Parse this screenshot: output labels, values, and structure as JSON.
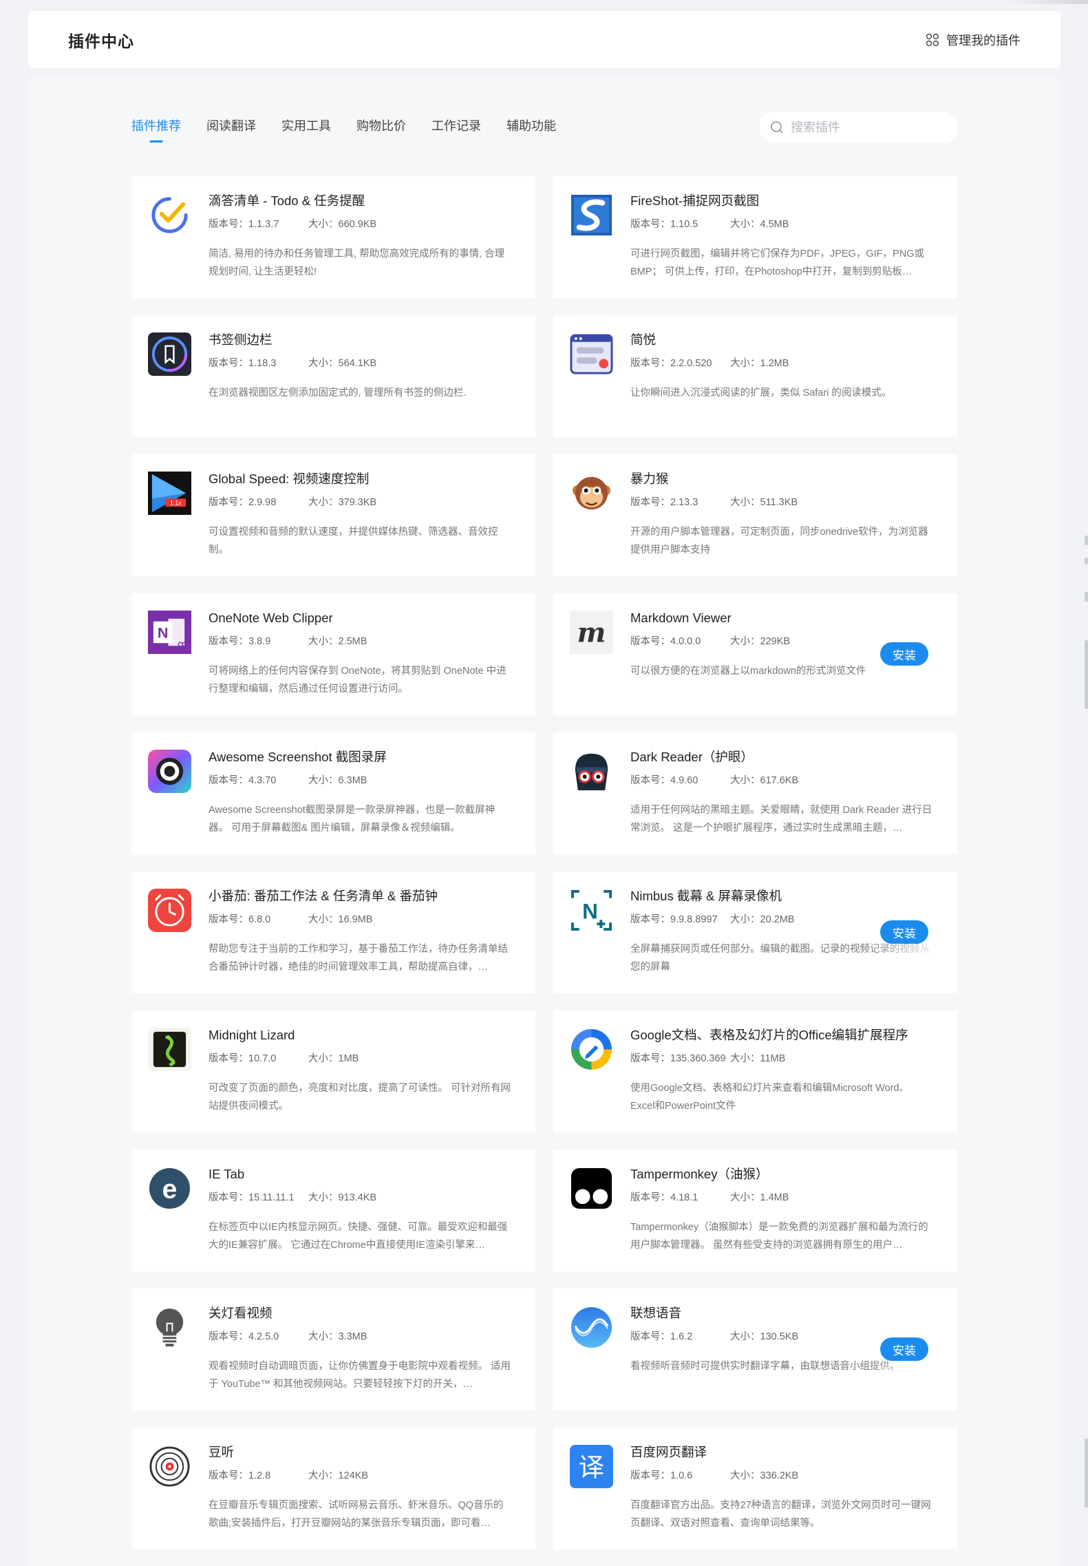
{
  "header": {
    "title": "插件中心",
    "manage_label": "管理我的插件"
  },
  "tabs": [
    {
      "label": "插件推荐",
      "active": true
    },
    {
      "label": "阅读翻译",
      "active": false
    },
    {
      "label": "实用工具",
      "active": false
    },
    {
      "label": "购物比价",
      "active": false
    },
    {
      "label": "工作记录",
      "active": false
    },
    {
      "label": "辅助功能",
      "active": false
    }
  ],
  "search": {
    "placeholder": "搜索插件",
    "value": ""
  },
  "install_label": "安装",
  "accent_color": "#1a8cf0",
  "plugins": [
    {
      "name": "滴答清单 - Todo & 任务提醒",
      "version": "版本号：1.1.3.7",
      "size": "大小：660.9KB",
      "desc": "简洁, 易用的待办和任务管理工具, 帮助您高效完成所有的事情, 合理规划时间, 让生活更轻松!",
      "icon": "ticktick-icon"
    },
    {
      "name": "FireShot-捕捉网页截图",
      "version": "版本号：1.10.5",
      "size": "大小：4.5MB",
      "desc": "可进行网页截图，编辑并将它们保存为PDF，JPEG，GIF，PNG或BMP； 可供上传，打印，在Photoshop中打开，复制到剪贴板…",
      "icon": "fireshot-icon"
    },
    {
      "name": "书签侧边栏",
      "version": "版本号：1.18.3",
      "size": "大小：564.1KB",
      "desc": "在浏览器视图区左侧添加固定式的, 管理所有书签的侧边栏.",
      "icon": "bookmark-sidebar-icon"
    },
    {
      "name": "简悦",
      "version": "版本号：2.2.0.520",
      "size": "大小：1.2MB",
      "desc": "让你瞬间进入沉浸式阅读的扩展，类似 Safari 的阅读模式。",
      "icon": "simpread-icon"
    },
    {
      "name": "Global Speed: 视频速度控制",
      "version": "版本号：2.9.98",
      "size": "大小：379.3KB",
      "desc": "可设置视频和音频的默认速度，并提供媒体热键、筛选器、音效控制。",
      "icon": "global-speed-icon",
      "badge": "1.1x"
    },
    {
      "name": "暴力猴",
      "version": "版本号：2.13.3",
      "size": "大小：511.3KB",
      "desc": "开源的用户脚本管理器，可定制页面，同步onedrive软件，为浏览器提供用户脚本支持",
      "icon": "violentmonkey-icon"
    },
    {
      "name": "OneNote Web Clipper",
      "version": "版本号：3.8.9",
      "size": "大小：2.5MB",
      "desc": "可将网络上的任何内容保存到 OneNote，将其剪贴到 OneNote 中进行整理和编辑，然后通过任何设置进行访问。",
      "icon": "onenote-icon"
    },
    {
      "name": "Markdown Viewer",
      "version": "版本号：4.0.0.0",
      "size": "大小：229KB",
      "desc": "可以很方便的在浏览器上以markdown的形式浏览文件",
      "icon": "markdown-viewer-icon",
      "install": true
    },
    {
      "name": "Awesome Screenshot 截图录屏",
      "version": "版本号：4.3.70",
      "size": "大小：6.3MB",
      "desc": "Awesome Screenshot截图录屏是一款录屏神器，也是一款截屏神器。 可用于屏幕截图& 图片编辑，屏幕录像＆视频编辑。",
      "icon": "awesome-screenshot-icon"
    },
    {
      "name": "Dark Reader（护眼）",
      "version": "版本号：4.9.60",
      "size": "大小：617.6KB",
      "desc": "适用于任何网站的黑暗主题。关爱眼睛，就使用 Dark Reader 进行日常浏览。 这是一个护眼扩展程序，通过实时生成黑暗主题，…",
      "icon": "dark-reader-icon"
    },
    {
      "name": "小番茄: 番茄工作法 & 任务清单 & 番茄钟",
      "version": "版本号：6.8.0",
      "size": "大小：16.9MB",
      "desc": "帮助您专注于当前的工作和学习，基于番茄工作法，待办任务清单结合番茄钟计时器，绝佳的时间管理效率工具，帮助提高自律，…",
      "icon": "tomato-clock-icon"
    },
    {
      "name": "Nimbus 截幕 & 屏幕录像机",
      "version": "版本号：9.9.8.8997",
      "size": "大小：20.2MB",
      "desc": "全屏幕捕获网页或任何部分。编辑的截图。记录的视频记录的视频从您的屏幕",
      "icon": "nimbus-icon",
      "install": true
    },
    {
      "name": "Midnight Lizard",
      "version": "版本号：10.7.0",
      "size": "大小：1MB",
      "desc": "可改变了页面的颜色，亮度和对比度，提高了可读性。 可针对所有网站提供夜间模式。",
      "icon": "midnight-lizard-icon"
    },
    {
      "name": "Google文档、表格及幻灯片的Office编辑扩展程序",
      "version": "版本号：135.360.369",
      "size": "大小：11MB",
      "desc": "使用Google文档、表格和幻灯片来查看和编辑Microsoft Word、Excel和PowerPoint文件",
      "icon": "google-docs-office-icon"
    },
    {
      "name": "IE Tab",
      "version": "版本号：15.11.11.1",
      "size": "大小：913.4KB",
      "desc": "在标签页中以IE内核显示网页。快捷、强健、可靠。最受欢迎和最强大的IE兼容扩展。 它通过在Chrome中直接使用IE渲染引擎来…",
      "icon": "ie-tab-icon"
    },
    {
      "name": "Tampermonkey（油猴）",
      "version": "版本号：4.18.1",
      "size": "大小：1.4MB",
      "desc": "Tampermonkey（油猴脚本）是一款免费的浏览器扩展和最为流行的用户脚本管理器。 虽然有些受支持的浏览器拥有原生的用户…",
      "icon": "tampermonkey-icon"
    },
    {
      "name": "关灯看视频",
      "version": "版本号：4.2.5.0",
      "size": "大小：3.3MB",
      "desc": "观看视频时自动调暗页面，让你仿佛置身于电影院中观看视频。 适用于 YouTube™ 和其他视频网站。只要轻轻按下灯的开关，…",
      "icon": "light-bulb-icon"
    },
    {
      "name": "联想语音",
      "version": "版本号：1.6.2",
      "size": "大小：130.5KB",
      "desc": "看视频听音频时可提供实时翻译字幕，由联想语音小组提供。",
      "icon": "lenovo-voice-icon",
      "install": true
    },
    {
      "name": "豆听",
      "version": "版本号：1.2.8",
      "size": "大小：124KB",
      "desc": "在豆瓣音乐专辑页面搜索、试听网易云音乐、虾米音乐、QQ音乐的歌曲;安装插件后，打开豆瓣网站的某张音乐专辑页面，即可看…",
      "icon": "vinyl-record-icon"
    },
    {
      "name": "百度网页翻译",
      "version": "版本号：1.0.6",
      "size": "大小：336.2KB",
      "desc": "百度翻译官方出品。支持27种语言的翻译，浏览外文网页时可一键网页翻译、双语对照查看、查询单词结果等。",
      "icon": "baidu-translate-icon",
      "glyph": "译"
    }
  ]
}
